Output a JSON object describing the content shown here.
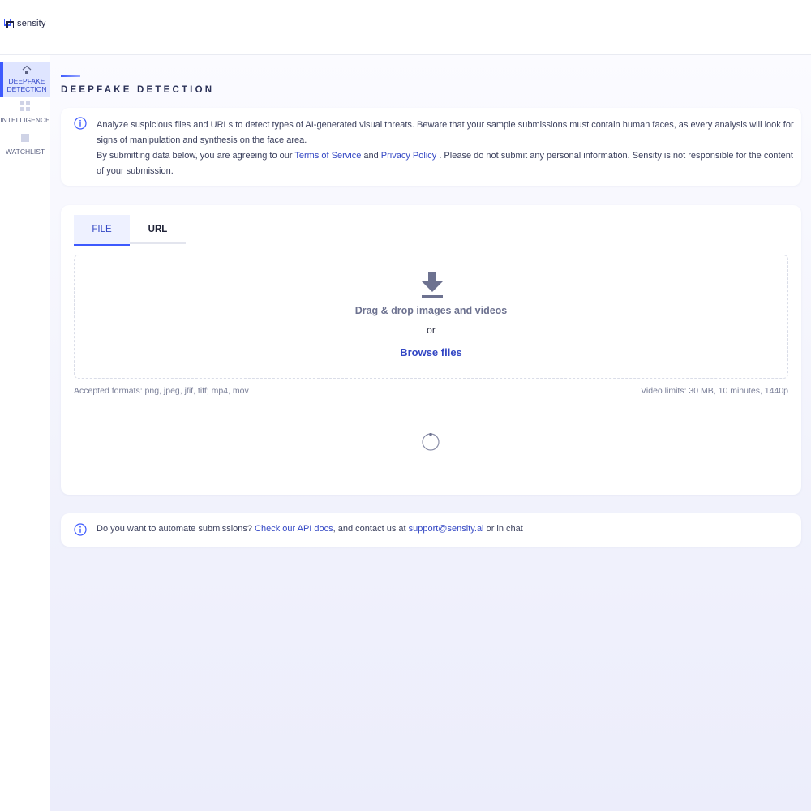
{
  "app": {
    "logo_text": "sensity",
    "brand_color": "#3d5afe"
  },
  "sidebar": {
    "items": [
      {
        "label": "DEEPFAKE DETECTION",
        "icon": "home-icon",
        "active": true
      },
      {
        "label": "INTELLIGENCE",
        "icon": "grid-icon",
        "active": false
      },
      {
        "label": "WATCHLIST",
        "icon": "square-icon",
        "active": false
      }
    ]
  },
  "page": {
    "title": "DEEPFAKE DETECTION"
  },
  "info": {
    "line1": "Analyze suspicious files and URLs to detect types of AI-generated visual threats. Beware that your sample submissions must contain human faces, as every analysis will look for signs of manipulation and synthesis on the face area.",
    "line2_prefix": "By submitting data below, you are agreeing to our ",
    "terms_link": "Terms of Service",
    "and": " and ",
    "privacy_link": "Privacy Policy",
    "line2_suffix": " . Please do not submit any personal information. Sensity is not responsible for the content of your submission."
  },
  "upload": {
    "tabs": [
      {
        "label": "FILE",
        "active": true
      },
      {
        "label": "URL",
        "active": false
      }
    ],
    "drop_text": "Drag & drop images and videos",
    "or_text": "or",
    "browse_label": "Browse files",
    "formats": "Accepted formats: png, jpeg, jfif, tiff; mp4, mov",
    "limits": "Video limits: 30 MB, 10 minutes, 1440p"
  },
  "api": {
    "prefix": "Do you want to automate submissions? ",
    "docs_link": "Check our API docs",
    "middle": ", and contact us at ",
    "email_link": "support@sensity.ai",
    "suffix": " or in chat"
  }
}
